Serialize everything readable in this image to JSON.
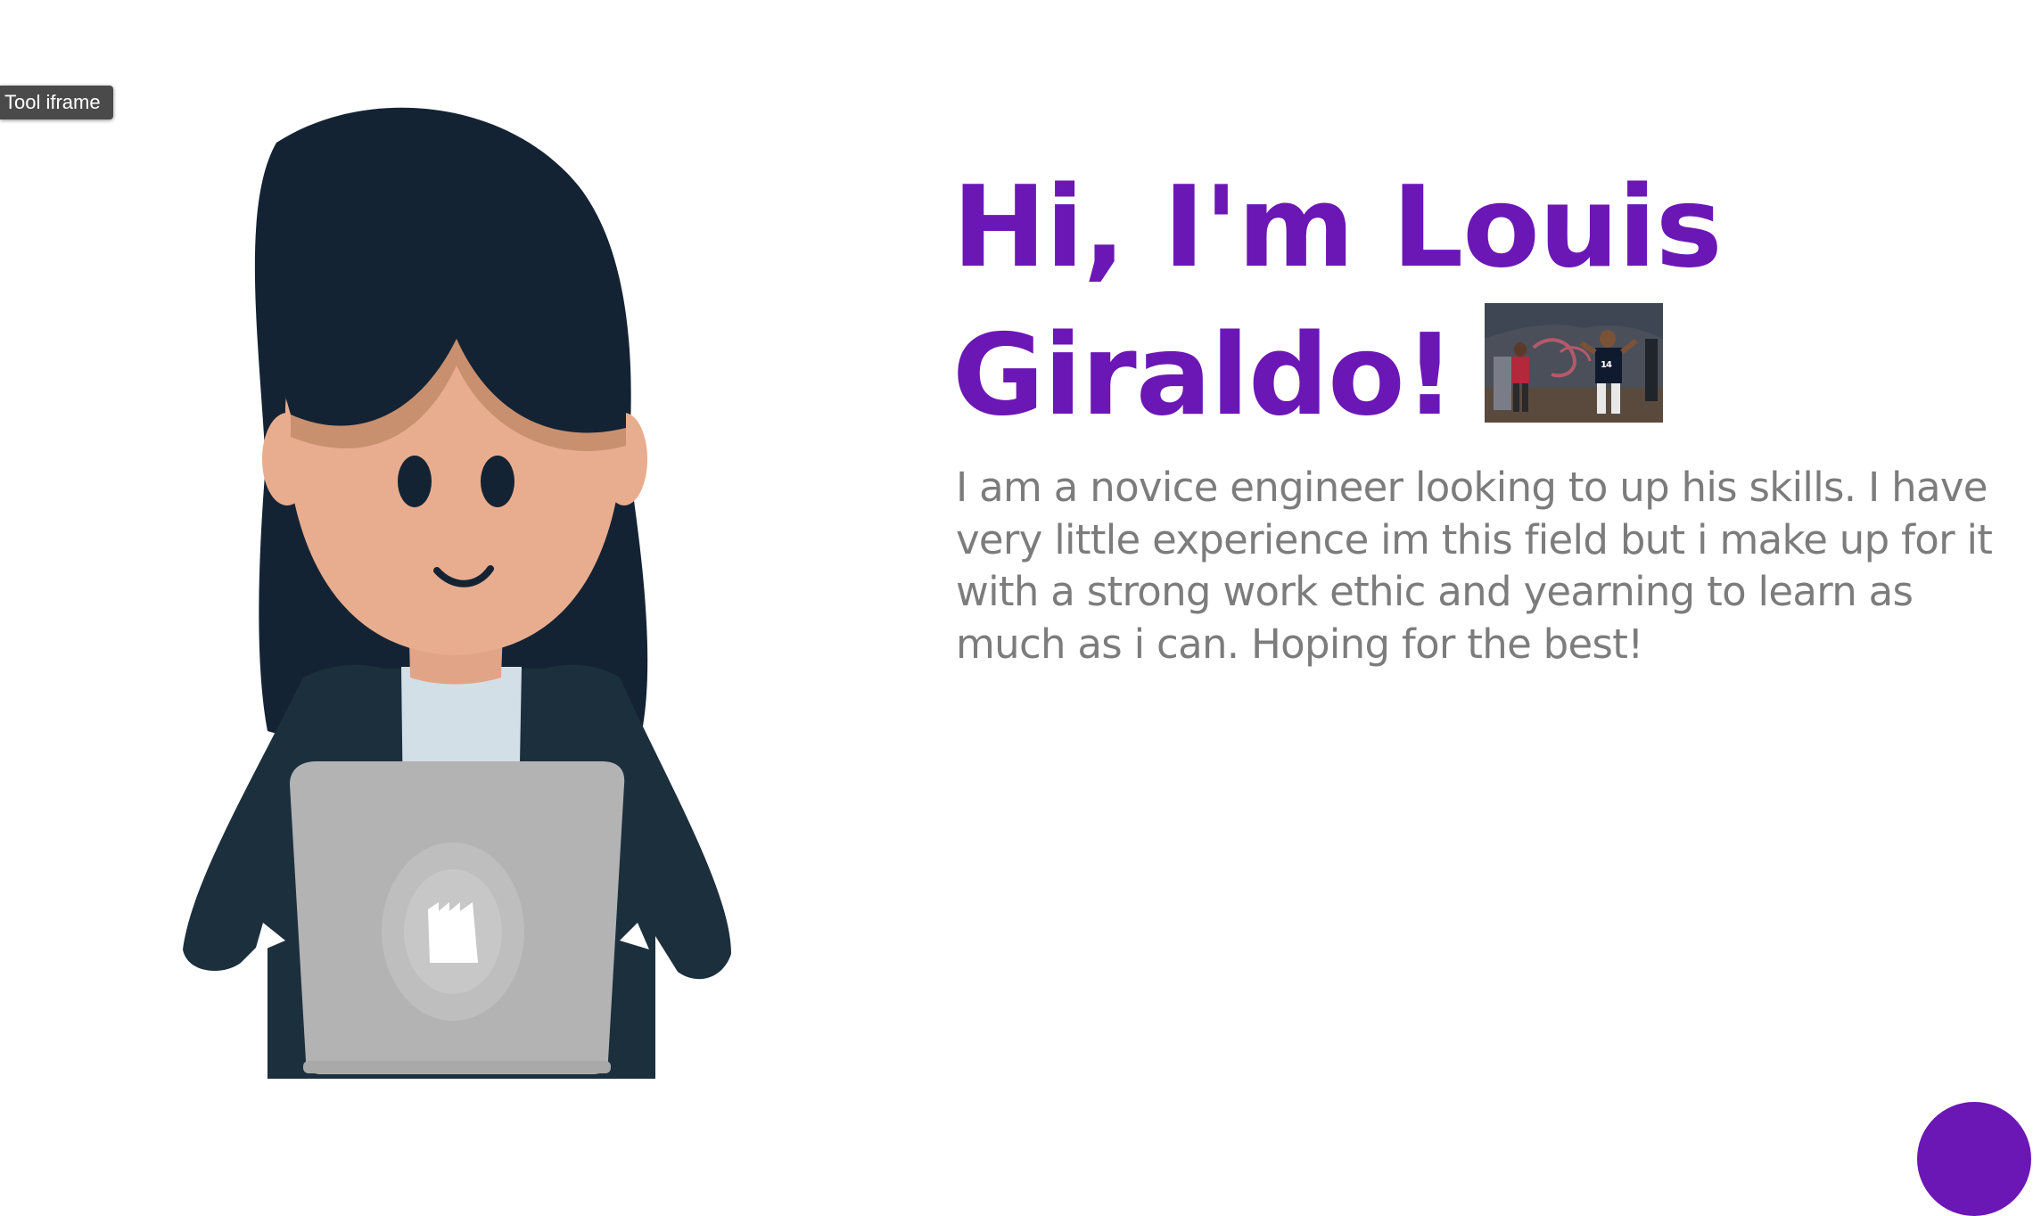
{
  "tool_label": "Tool iframe",
  "hero": {
    "title_line1": "Hi, I'm Louis",
    "title_line2": "Giraldo!",
    "bio": "I am a novice engineer looking to up his skills. I have very little experience im this field but i make up for it with a strong work ethic and yearning to learn as much as i can. Hoping for the best!"
  },
  "colors": {
    "accent": "#6b17b5",
    "body_text": "#7c7c7c",
    "background": "#ffffff"
  },
  "icons": {
    "illustration": "person-with-laptop-illustration",
    "photo": "performer-photo-thumbnail",
    "fab": "floating-action-button"
  }
}
